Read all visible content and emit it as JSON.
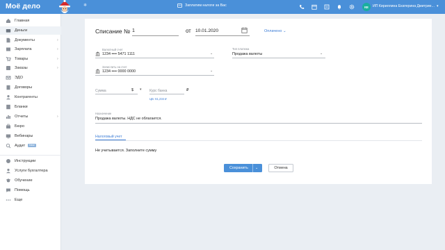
{
  "header": {
    "logo": "Моё дело",
    "promo": "Заплатим налоги за Вас",
    "user_initials": "КЕ",
    "user_name": "ИП Кириллина Екатерина Дмитрие..."
  },
  "sidebar": {
    "items": [
      {
        "label": "Главная",
        "icon": "home-icon"
      },
      {
        "label": "Деньги",
        "icon": "wallet-icon"
      },
      {
        "label": "Документы",
        "icon": "document-icon"
      },
      {
        "label": "Зарплата",
        "icon": "salary-icon"
      },
      {
        "label": "Товары",
        "icon": "cart-icon"
      },
      {
        "label": "Заказы",
        "icon": "orders-icon"
      },
      {
        "label": "ЭДО",
        "icon": "edo-icon"
      },
      {
        "label": "Договоры",
        "icon": "contract-icon"
      },
      {
        "label": "Контрагенты",
        "icon": "contacts-icon"
      },
      {
        "label": "Бланки",
        "icon": "forms-icon"
      },
      {
        "label": "Отчеты",
        "icon": "reports-icon"
      },
      {
        "label": "Бюро",
        "icon": "bureau-icon"
      },
      {
        "label": "Вебинары",
        "icon": "webinar-icon"
      },
      {
        "label": "Аудит",
        "icon": "audit-icon",
        "badge": "New"
      }
    ],
    "secondary": [
      {
        "label": "Инструкции",
        "icon": "help-circle-icon"
      },
      {
        "label": "Услуги бухгалтера",
        "icon": "accountant-icon"
      },
      {
        "label": "Обучение",
        "icon": "education-icon"
      },
      {
        "label": "Помощь",
        "icon": "chat-icon"
      },
      {
        "label": "Еще",
        "icon": "more-icon"
      }
    ]
  },
  "form": {
    "title": "Списание №",
    "number": "1",
    "date_prefix": "от",
    "date": "10.01.2020",
    "status": "Оплачено",
    "account_label": "Валютный счет",
    "account_value": "1234 •••• 5471 1111",
    "payment_type_label": "Тип платежа",
    "payment_type_value": "Продажа валюты",
    "credit_label": "Зачислить на счет",
    "credit_value": "1234 •••• 0000 0000",
    "sum_placeholder": "Сумма",
    "currency": "$",
    "rate_placeholder": "Курс банка",
    "rub_sign": "₽",
    "cbr_rate": "ЦБ: 61,234 ₽",
    "purpose_label": "Назначение",
    "purpose_value": "Продажа валюты. НДС не облагается.",
    "tax_tab": "Налоговый учет",
    "tax_text": "Не учитывается. Заполните сумму",
    "save": "Сохранить",
    "cancel": "Отмена"
  }
}
